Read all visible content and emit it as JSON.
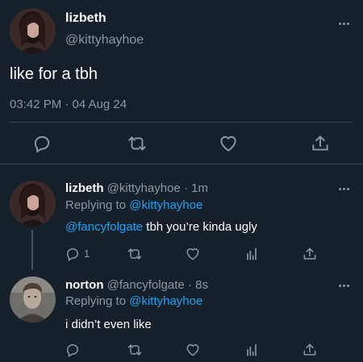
{
  "main_tweet": {
    "display_name": "lizbeth",
    "handle": "@kittyhayhoe",
    "text": "like for a tbh",
    "timestamp": "03:42 PM · 04 Aug 24",
    "actions": [
      "reply-icon",
      "retweet-icon",
      "like-icon",
      "share-icon"
    ]
  },
  "replies": [
    {
      "display_name": "lizbeth",
      "handle_time": "@kittyhayhoe · 1m",
      "replying_prefix": "Replying to ",
      "replying_to": "@kittyhayhoe",
      "mention": "@fancyfolgate",
      "text": " tbh you’re kinda ugly",
      "reply_count": "1"
    },
    {
      "display_name": "norton",
      "handle_time": "@fancyfolgate · 8s",
      "replying_prefix": "Replying to ",
      "replying_to": "@kittyhayhoe",
      "text": "i didn’t even like",
      "reply_count": ""
    }
  ],
  "colors": {
    "background": "#15202b",
    "secondary_text": "#8899a6",
    "link": "#1da1f2",
    "divider": "#38444d"
  }
}
